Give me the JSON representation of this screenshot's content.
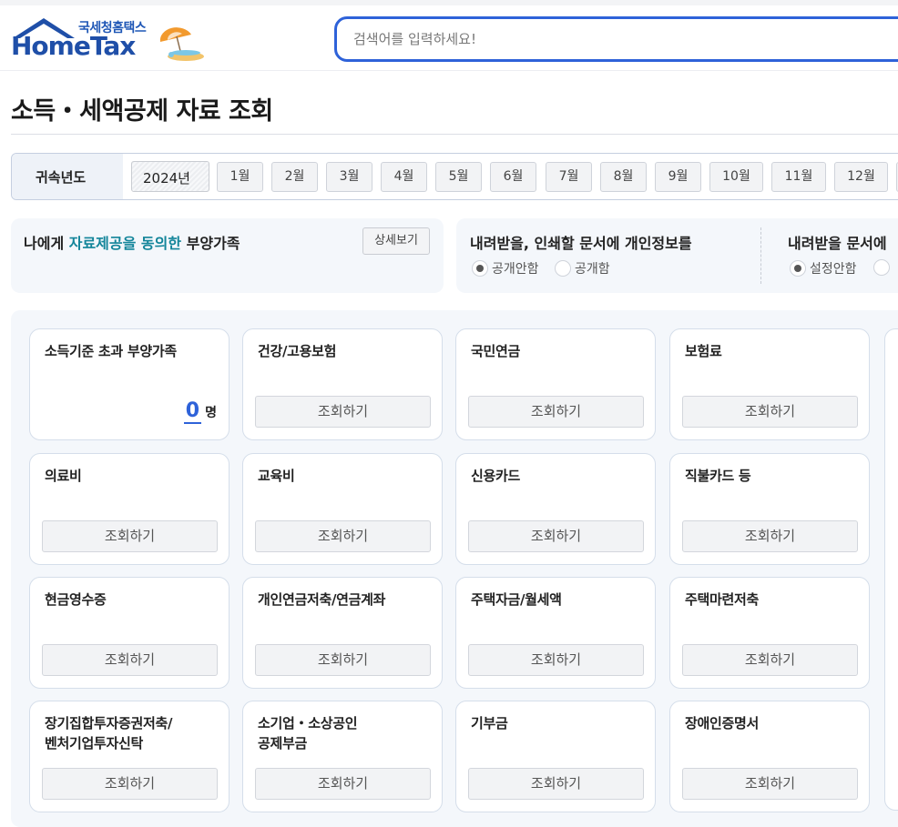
{
  "header": {
    "logo_sub": "국세청홈택스",
    "logo_main": "HomeTax",
    "search_placeholder": "검색어를 입력하세요!"
  },
  "page": {
    "title": "소득・세액공제 자료 조회"
  },
  "year_bar": {
    "label": "귀속년도",
    "selected_year": "2024년",
    "months": [
      "1월",
      "2월",
      "3월",
      "4월",
      "5월",
      "6월",
      "7월",
      "8월",
      "9월",
      "10월",
      "11월",
      "12월"
    ]
  },
  "dependents_panel": {
    "title_prefix": "나에게 ",
    "title_highlight": "자료제공을 동의한",
    "title_suffix": " 부양가족",
    "detail_button": "상세보기"
  },
  "privacy_panel": {
    "title": "내려받을, 인쇄할 문서에 개인정보를",
    "option_hide": "공개안함",
    "option_show": "공개함",
    "selected": "공개안함"
  },
  "download_panel": {
    "title": "내려받을 문서에",
    "option_off": "설정안함",
    "selected": "설정안함"
  },
  "cards": [
    {
      "title": "소득기준 초과 부양가족",
      "count": "0",
      "unit": "명"
    },
    {
      "title": "건강/고용보험",
      "button": "조회하기"
    },
    {
      "title": "국민연금",
      "button": "조회하기"
    },
    {
      "title": "보험료",
      "button": "조회하기"
    },
    {
      "title": "의료비",
      "button": "조회하기"
    },
    {
      "title": "교육비",
      "button": "조회하기"
    },
    {
      "title": "신용카드",
      "button": "조회하기"
    },
    {
      "title": "직불카드 등",
      "button": "조회하기"
    },
    {
      "title": "현금영수증",
      "button": "조회하기"
    },
    {
      "title": "개인연금저축/연금계좌",
      "button": "조회하기"
    },
    {
      "title": "주택자금/월세액",
      "button": "조회하기"
    },
    {
      "title": "주택마련저축",
      "button": "조회하기"
    },
    {
      "title": "장기집합투자증권저축/\n벤처기업투자신탁",
      "title_line1": "장기집합투자증권저축/",
      "title_line2": "벤처기업투자신탁",
      "button": "조회하기"
    },
    {
      "title": "소기업・소상공인\n공제부금",
      "title_line1": "소기업・소상공인",
      "title_line2": "공제부금",
      "button": "조회하기"
    },
    {
      "title": "기부금",
      "button": "조회하기"
    },
    {
      "title": "장애인증명서",
      "button": "조회하기"
    }
  ],
  "colors": {
    "accent": "#2e62d9",
    "highlight": "#13859a",
    "brand": "#1f4fa8"
  }
}
